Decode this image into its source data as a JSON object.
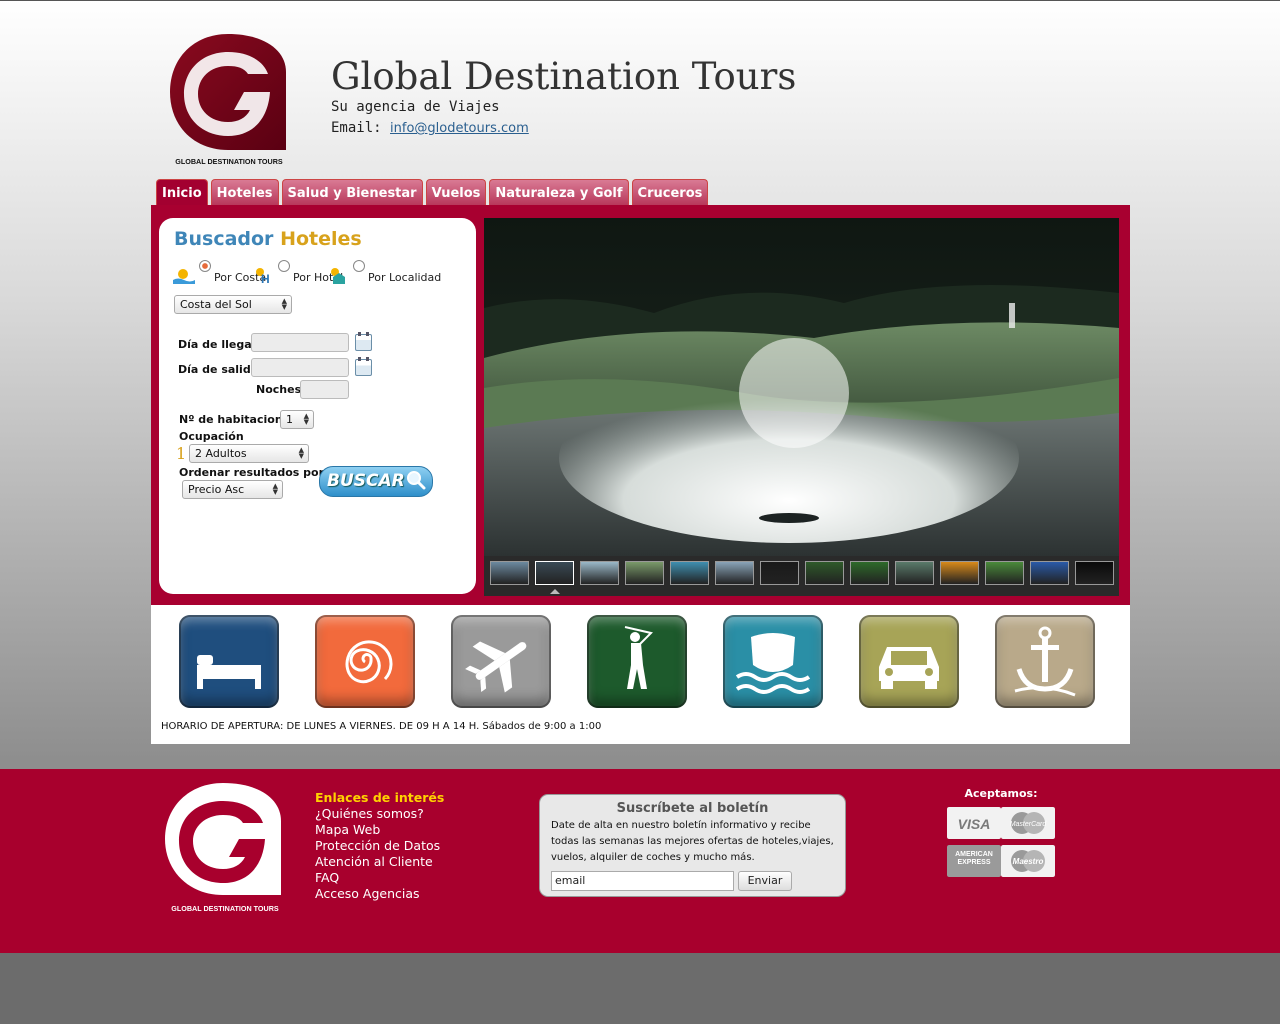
{
  "header": {
    "site_title": "Global Destination Tours",
    "tagline": "Su agencia de Viajes",
    "email_label": "Email:",
    "email": "info@glodetours.com",
    "logo_caption": "GLOBAL DESTINATION TOURS"
  },
  "nav": {
    "tabs": [
      {
        "label": "Inicio",
        "active": true
      },
      {
        "label": "Hoteles"
      },
      {
        "label": "Salud y Bienestar"
      },
      {
        "label": "Vuelos"
      },
      {
        "label": "Naturaleza y Golf"
      },
      {
        "label": "Cruceros"
      }
    ]
  },
  "search": {
    "title_part1": "Buscador",
    "title_part2": "Hoteles",
    "modes": [
      {
        "label": "Por Costa",
        "selected": true
      },
      {
        "label": "Por Hotel",
        "selected": false
      },
      {
        "label": "Por Localidad",
        "selected": false
      }
    ],
    "costa_value": "Costa del Sol",
    "arrival_label": "Día de llegada",
    "departure_label": "Día de salida",
    "nights_label": "Noches",
    "rooms_label": "Nº de habitaciones:",
    "rooms_value": "1",
    "occupancy_label": "Ocupación",
    "occupancy_index": "1",
    "occupancy_value": "2 Adultos",
    "sort_label": "Ordenar resultados por...",
    "sort_value": "Precio Asc",
    "search_button": "BUSCAR"
  },
  "slideshow": {
    "thumbnail_count": 14,
    "active_thumbnail": 2
  },
  "categories": [
    {
      "name": "hoteles",
      "icon": "bed-icon",
      "color": "#1f4e7e"
    },
    {
      "name": "salud",
      "icon": "spiral-icon",
      "color": "#f26a3c"
    },
    {
      "name": "vuelos",
      "icon": "airplane-icon",
      "color": "#9a9a9a"
    },
    {
      "name": "golf",
      "icon": "golfer-icon",
      "color": "#1d5a2c"
    },
    {
      "name": "cruceros",
      "icon": "ship-shield-icon",
      "color": "#2a8fa6"
    },
    {
      "name": "coches",
      "icon": "car-icon",
      "color": "#a7a457"
    },
    {
      "name": "nautica",
      "icon": "anchor-icon",
      "color": "#b9a98a"
    }
  ],
  "hours": "HORARIO DE APERTURA: DE LUNES A VIERNES. DE 09 H A 14 H. Sábados de 9:00 a 1:00",
  "footer": {
    "links_heading": "Enlaces de interés",
    "links": [
      "¿Quiénes somos?",
      "Mapa Web",
      "Protección de Datos",
      "Atención al Cliente",
      "FAQ",
      "Acceso Agencias"
    ],
    "newsletter_title": "Suscríbete al boletín",
    "newsletter_text": "Date de alta en nuestro boletín informativo y recibe todas las semanas las mejores ofertas de hoteles,viajes, vuelos, alquiler de coches y mucho más.",
    "newsletter_placeholder": "email",
    "newsletter_button": "Enviar",
    "accept_label": "Aceptamos:",
    "cards": [
      "VISA",
      "MasterCard",
      "AMERICAN EXPRESS",
      "Maestro"
    ]
  },
  "colors": {
    "brand": "#a8002d",
    "accent_blue": "#3f86b8",
    "accent_gold": "#d8a21c"
  }
}
